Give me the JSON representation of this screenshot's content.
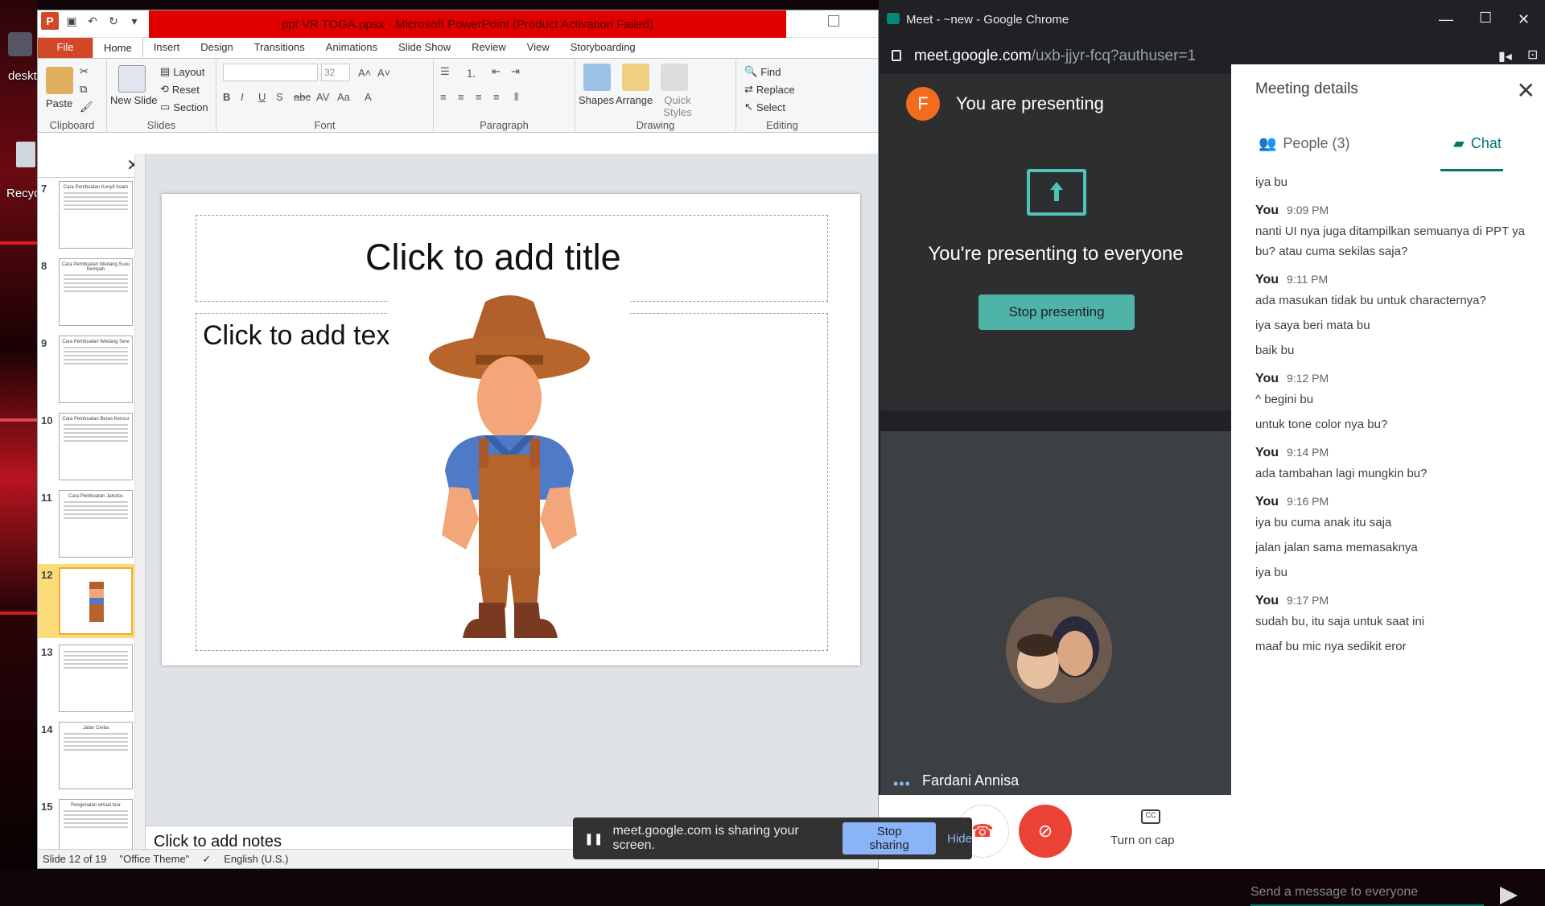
{
  "desktop": {
    "label1": "deskt",
    "label2": "Recyc"
  },
  "ppt": {
    "title": "ppt VR TOGA.ppsx  -  Microsoft PowerPoint (Product Activation Failed)",
    "tabs": [
      "File",
      "Home",
      "Insert",
      "Design",
      "Transitions",
      "Animations",
      "Slide Show",
      "Review",
      "View",
      "Storyboarding"
    ],
    "ribbon": {
      "paste": "Paste",
      "clipboard": "Clipboard",
      "new_slide": "New Slide",
      "layout": "Layout",
      "reset": "Reset",
      "section": "Section",
      "slides": "Slides",
      "font_size": "32",
      "font": "Font",
      "paragraph": "Paragraph",
      "shapes": "Shapes",
      "arrange": "Arrange",
      "quick_styles": "Quick Styles",
      "drawing": "Drawing",
      "find": "Find",
      "replace": "Replace",
      "select": "Select",
      "editing": "Editing"
    },
    "thumbs": [
      {
        "num": "7",
        "title": "Cara Pembuatan Kunyit Asam"
      },
      {
        "num": "8",
        "title": "Cara Pembuatan Wedang Susu Rempah"
      },
      {
        "num": "9",
        "title": "Cara Pembuatan Wedang Sere"
      },
      {
        "num": "10",
        "title": "Cara Pembuatan Beras Kencur"
      },
      {
        "num": "11",
        "title": "Cara Pembuatan Jakutos"
      },
      {
        "num": "12",
        "title": ""
      },
      {
        "num": "13",
        "title": ""
      },
      {
        "num": "14",
        "title": "Jalan Cerita"
      },
      {
        "num": "15",
        "title": "Pengenalan virtual tour"
      }
    ],
    "slide": {
      "title_ph": "Click to add title",
      "text_ph": "Click to add tex"
    },
    "notes": "Click to add notes",
    "status": {
      "slide": "Slide 12 of 19",
      "theme": "\"Office Theme\"",
      "lang": "English (U.S.)"
    }
  },
  "chrome": {
    "title": "Meet - ~new - Google Chrome",
    "url_host": "meet.google.com",
    "url_path": "/uxb-jjyr-fcq?authuser=1"
  },
  "meet": {
    "avatar_letter": "F",
    "you_presenting": "You are presenting",
    "presenting_everyone": "You're presenting to everyone",
    "stop_presenting": "Stop presenting",
    "participant": "Fardani Annisa",
    "turn_on_cap": "Turn on cap",
    "details_title": "Meeting details",
    "people_tab": "People (3)",
    "chat_tab": "Chat",
    "send_placeholder": "Send a message to everyone",
    "messages": [
      {
        "sender": "",
        "time": "",
        "lines": [
          "iya bu"
        ]
      },
      {
        "sender": "You",
        "time": "9:09 PM",
        "lines": [
          "nanti UI nya juga ditampilkan semuanya di PPT ya bu? atau cuma sekilas saja?"
        ]
      },
      {
        "sender": "You",
        "time": "9:11 PM",
        "lines": [
          "ada masukan tidak bu untuk characternya?",
          "iya saya beri mata bu",
          "baik bu"
        ]
      },
      {
        "sender": "You",
        "time": "9:12 PM",
        "lines": [
          "^ begini bu",
          "untuk tone color nya bu?"
        ]
      },
      {
        "sender": "You",
        "time": "9:14 PM",
        "lines": [
          "ada tambahan lagi mungkin bu?"
        ]
      },
      {
        "sender": "You",
        "time": "9:16 PM",
        "lines": [
          "iya bu cuma anak itu saja",
          "jalan jalan sama memasaknya",
          "iya bu"
        ]
      },
      {
        "sender": "You",
        "time": "9:17 PM",
        "lines": [
          "sudah bu, itu saja untuk saat ini",
          "maaf bu mic nya sedikit eror"
        ]
      }
    ],
    "snack": {
      "message": "meet.google.com is sharing your screen.",
      "stop": "Stop sharing",
      "hide": "Hide"
    }
  },
  "colors": {
    "ppt_accent": "#d24726",
    "meet_teal": "#00796b",
    "activation_bar": "#e00000",
    "end_call": "#ea4335"
  }
}
